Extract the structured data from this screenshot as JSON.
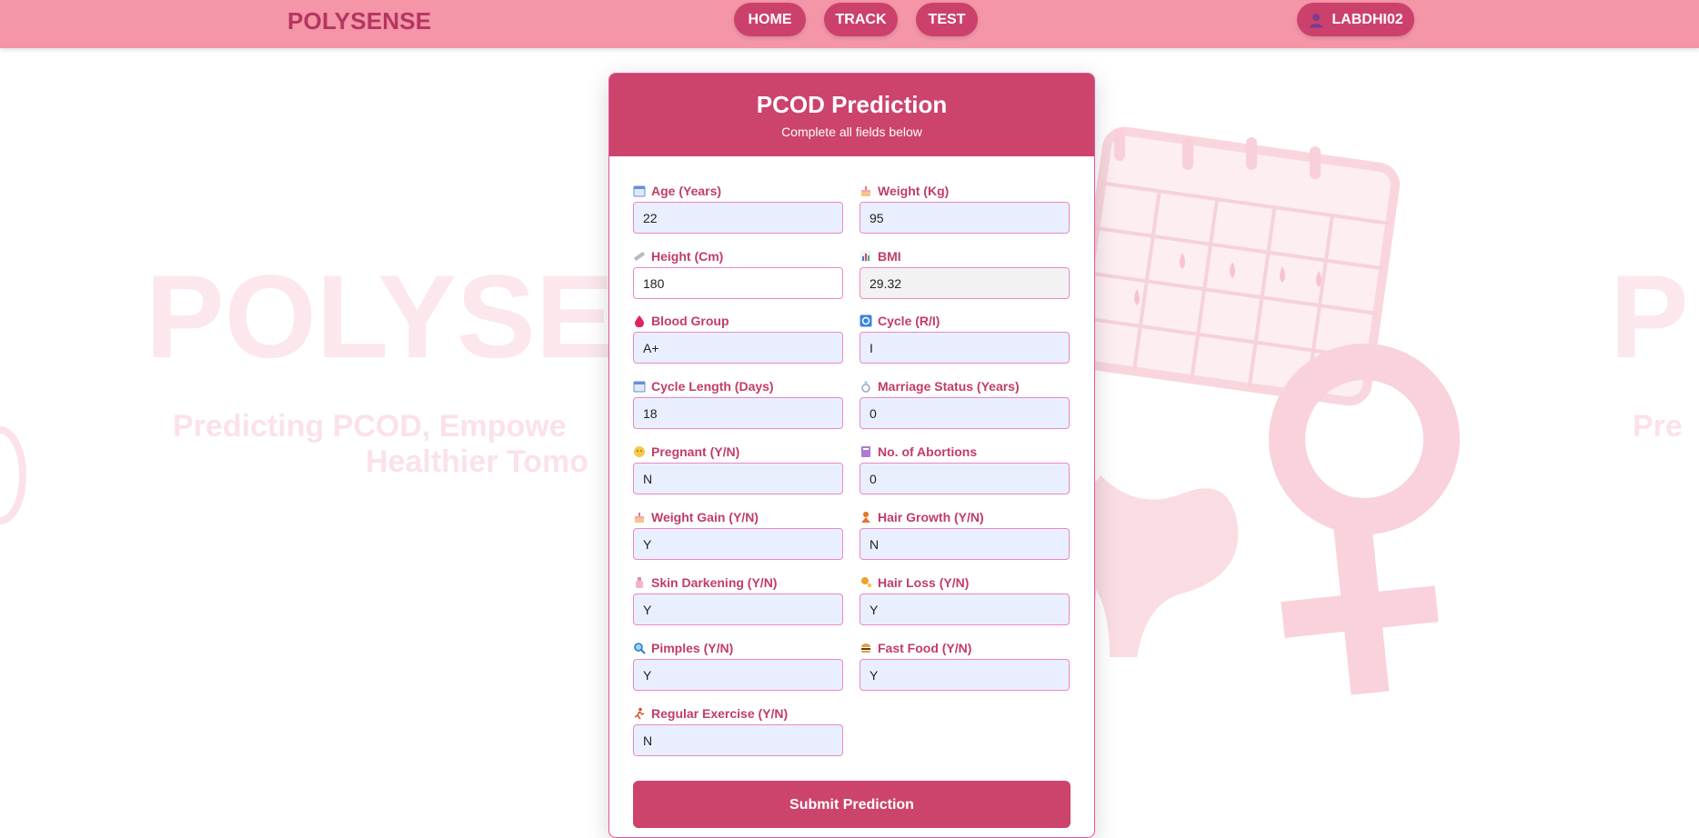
{
  "nav": {
    "brand": "POLYSENSE",
    "links": [
      "HOME",
      "TRACK",
      "TEST"
    ],
    "user": "LABDHI02"
  },
  "background": {
    "watermark_left": "POLYSE",
    "watermark_right": "P",
    "tagline_line1": "Predicting PCOD, Empowe",
    "tagline_line2": "Healthier Tomo",
    "tagline_right": "Pre"
  },
  "form": {
    "title": "PCOD Prediction",
    "subtitle": "Complete all fields below",
    "fields": [
      {
        "label": "Age (Years)",
        "value": "22",
        "icon": "calendar-icon"
      },
      {
        "label": "Weight (Kg)",
        "value": "95",
        "icon": "cake-icon"
      },
      {
        "label": "Height (Cm)",
        "value": "180",
        "icon": "ruler-icon"
      },
      {
        "label": "BMI",
        "value": "29.32",
        "icon": "bar-chart-icon"
      },
      {
        "label": "Blood Group",
        "value": "A+",
        "icon": "blood-drop-icon"
      },
      {
        "label": "Cycle (R/I)",
        "value": "I",
        "icon": "cycle-arrows-icon"
      },
      {
        "label": "Cycle Length (Days)",
        "value": "18",
        "icon": "calendar-icon"
      },
      {
        "label": "Marriage Status (Years)",
        "value": "0",
        "icon": "ring-icon"
      },
      {
        "label": "Pregnant (Y/N)",
        "value": "N",
        "icon": "baby-icon"
      },
      {
        "label": "No. of Abortions",
        "value": "0",
        "icon": "notebook-icon"
      },
      {
        "label": "Weight Gain (Y/N)",
        "value": "Y",
        "icon": "cake-icon"
      },
      {
        "label": "Hair Growth (Y/N)",
        "value": "N",
        "icon": "woman-icon"
      },
      {
        "label": "Skin Darkening (Y/N)",
        "value": "Y",
        "icon": "lotion-bottle-icon"
      },
      {
        "label": "Hair Loss (Y/N)",
        "value": "Y",
        "icon": "woman-haircut-icon"
      },
      {
        "label": "Pimples (Y/N)",
        "value": "Y",
        "icon": "magnifier-icon"
      },
      {
        "label": "Fast Food (Y/N)",
        "value": "Y",
        "icon": "burger-icon"
      },
      {
        "label": "Regular Exercise (Y/N)",
        "value": "N",
        "icon": "runner-icon"
      }
    ],
    "submit_label": "Submit Prediction"
  },
  "colors": {
    "navbar": "#f495a8",
    "accent": "#cc436c",
    "label": "#c23c68",
    "input_bg": "#e9efff",
    "input_border": "#ec88c3"
  }
}
